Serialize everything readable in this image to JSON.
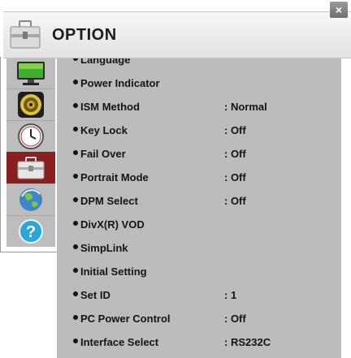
{
  "header": {
    "title": "OPTION",
    "close_glyph": "×",
    "icon": "toolbox-icon"
  },
  "rail": [
    {
      "icon": "monitor-icon"
    },
    {
      "icon": "speaker-icon"
    },
    {
      "icon": "clock-icon"
    },
    {
      "icon": "toolbox-icon",
      "active": true
    },
    {
      "icon": "globe-icon"
    },
    {
      "icon": "help-icon"
    }
  ],
  "menu": [
    {
      "label": "Language",
      "value": ""
    },
    {
      "label": "Power Indicator",
      "value": ""
    },
    {
      "label": "ISM Method",
      "value": ": Normal"
    },
    {
      "label": "Key Lock",
      "value": ": Off"
    },
    {
      "label": "Fail Over",
      "value": ": Off"
    },
    {
      "label": "Portrait Mode",
      "value": ": Off"
    },
    {
      "label": "DPM Select",
      "value": ": Off"
    },
    {
      "label": "DivX(R) VOD",
      "value": ""
    },
    {
      "label": "SimpLink",
      "value": ""
    },
    {
      "label": "Initial Setting",
      "value": ""
    },
    {
      "label": "Set ID",
      "value": ": 1"
    },
    {
      "label": "PC Power Control",
      "value": ": Off"
    },
    {
      "label": "Interface Select",
      "value": ": RS232C"
    }
  ],
  "colors": {
    "active_rail": "#8a1f1f",
    "content_bg": "#bcbcbc",
    "rail_bg": "#bdbdbd"
  }
}
